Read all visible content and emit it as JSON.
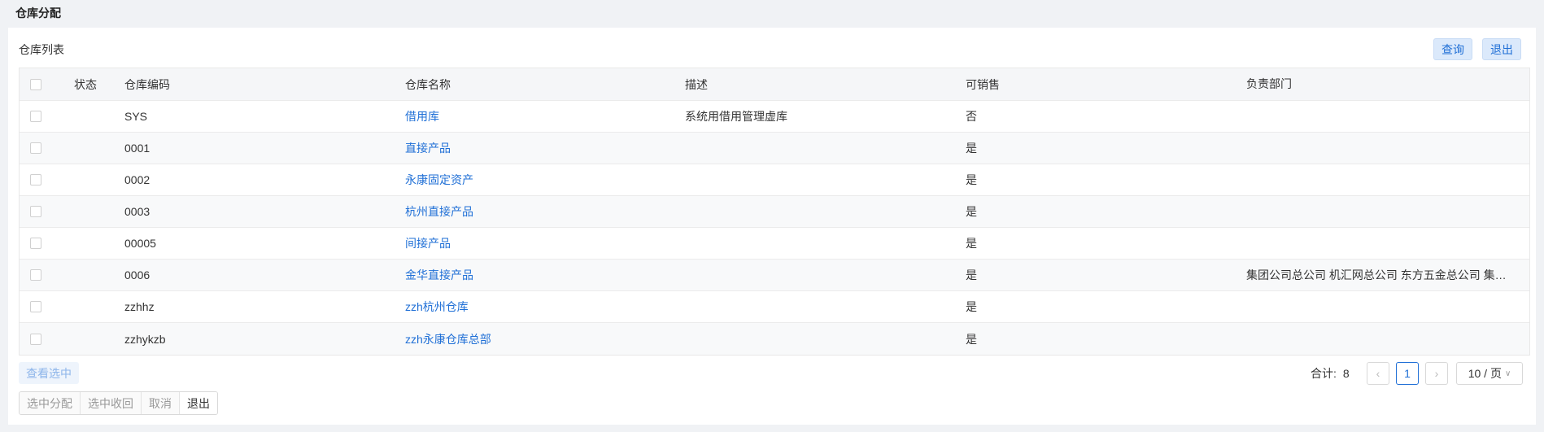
{
  "page": {
    "title": "仓库分配"
  },
  "panel": {
    "title": "仓库列表",
    "query_label": "查询",
    "exit_label": "退出"
  },
  "table": {
    "headers": {
      "status": "状态",
      "code": "仓库编码",
      "name": "仓库名称",
      "desc": "描述",
      "sellable": "可销售",
      "dept": "负责部门"
    },
    "rows": [
      {
        "code": "SYS",
        "name": "借用库",
        "desc": "系统用借用管理虚库",
        "sellable": "否",
        "dept": ""
      },
      {
        "code": "0001",
        "name": "直接产品",
        "desc": "",
        "sellable": "是",
        "dept": ""
      },
      {
        "code": "0002",
        "name": "永康固定资产",
        "desc": "",
        "sellable": "是",
        "dept": ""
      },
      {
        "code": "0003",
        "name": "杭州直接产品",
        "desc": "",
        "sellable": "是",
        "dept": ""
      },
      {
        "code": "00005",
        "name": "间接产品",
        "desc": "",
        "sellable": "是",
        "dept": ""
      },
      {
        "code": "0006",
        "name": "金华直接产品",
        "desc": "",
        "sellable": "是",
        "dept": "集团公司总公司 机汇网总公司 东方五金总公司 集团公司"
      },
      {
        "code": "zzhhz",
        "name": "zzh杭州仓库",
        "desc": "",
        "sellable": "是",
        "dept": ""
      },
      {
        "code": "zzhykzb",
        "name": "zzh永康仓库总部",
        "desc": "",
        "sellable": "是",
        "dept": ""
      }
    ]
  },
  "footer": {
    "view_selected_label": "查看选中",
    "total_label": "合计:",
    "total_count": "8",
    "current_page": "1",
    "page_size": "10 / 页",
    "actions": {
      "assign": "选中分配",
      "revoke": "选中收回",
      "cancel": "取消",
      "exit": "退出"
    }
  }
}
